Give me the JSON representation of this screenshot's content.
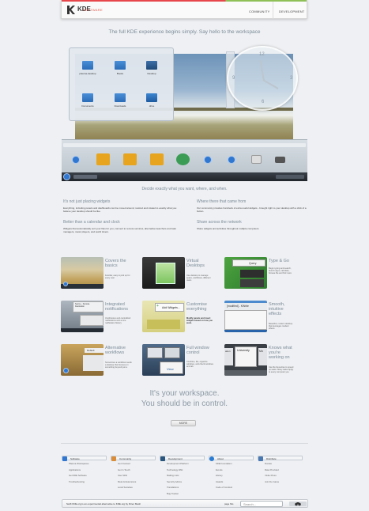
{
  "nav": {
    "logo": "KDE",
    "logo_sub": "SOFTWARE",
    "items": [
      "COMMUNITY",
      "DEVELOPMENT"
    ]
  },
  "hero": {
    "headline": "The full KDE experience begins simply. Say hello to the workspace",
    "folderview": [
      "plasma-desktop",
      "Books",
      "Desktop",
      "Documents",
      "Downloads",
      "drive"
    ],
    "clock": [
      "12",
      "3",
      "6",
      "9"
    ]
  },
  "section2": {
    "headline": "Decide exactly what you want, where, and when.",
    "cols": [
      {
        "h": "It's not just placing widgets",
        "p": "Everything, including panels and dashboards can be moved around, resized and rotated to exactly what you believe your desktop should be like."
      },
      {
        "h": "Where there that came from",
        "p": "Our community provides hundreds of extra useful widgets - brought right to your desktop with a click of a button."
      },
      {
        "h": "Better than a calendar and clock",
        "p": "Widgets that automatically sort your files for you, connect to remote services, alternative launchers and task managers, music players, and world timers."
      },
      {
        "h": "Share across the network",
        "p": "Share widgets and activities throughout multiple computers."
      }
    ]
  },
  "tiles": [
    {
      "title": "Covers the basics",
      "desc": "Familiar, easy to pick up for every user"
    },
    {
      "title": "Virtual Desktops",
      "desc": "Use desktop to manage space, workflows, different users"
    },
    {
      "title": "Type & Go",
      "desc": "Begin typing and search, launch apps, calculate, browse file and find more"
    },
    {
      "title": "Integrated notifications",
      "desc": "Unobtrusive and centralized notifications and a nice notification history"
    },
    {
      "title": "Customise everything",
      "desc": "Modify panels and insert widgets based on how you work."
    },
    {
      "title": "Smooth, intuitive effects",
      "desc": "Beautiful, modern desktop that leverages modern effects"
    },
    {
      "title": "Alternative workflows",
      "desc": "Sometimes a workflow needs a desktop that focuses on something beyond just a"
    },
    {
      "title": "Full window control",
      "desc": "Combine, tile, organize windows, and check windows and tab"
    },
    {
      "title": "Knows what you're working on",
      "desc": "Use file favourites to speed up tasks. Many tasks apply to every computer you"
    }
  ],
  "tile_labels": {
    "t3": "Query",
    "t4a": "Source - Konsole",
    "t4b": "Destination",
    "t4c": "Konsole",
    "t5": "Add Widgets...",
    "t6": "[modified] - KWrite",
    "t7": "Default",
    "t8": "View",
    "t9a": "ation",
    "t9b": "University",
    "t9c": "Mo"
  },
  "slogan": [
    "It's your workspace.",
    "You should be in control."
  ],
  "more": "MORE",
  "footer": {
    "cols": [
      {
        "title": "Software",
        "color": "#2f77d1",
        "links": [
          "Plasma Workspaces",
          "Applications",
          "Get KDE Software",
          "Troubleshooting"
        ]
      },
      {
        "title": "Community",
        "color": "#d98d3a",
        "links": [
          "Get Involved",
          "Get in Touch",
          "User Wiki",
          "Meta & Extensions",
          "Local Societies"
        ]
      },
      {
        "title": "Development",
        "color": "#29557e",
        "links": [
          "Development Platform",
          "Technology Wiki",
          "Mailing Lists",
          "Security Advice",
          "Translations",
          "Bug Tracker"
        ]
      },
      {
        "title": "About",
        "color": "#2a7cd3",
        "links": [
          "KDE Foundation",
          "Events",
          "History",
          "Awards",
          "Code of Conduct"
        ]
      },
      {
        "title": "Distribute",
        "color": "#4a78b0",
        "links": [
          "Donate",
          "Rate Provided",
          "Visite Press",
          "Join the Game"
        ]
      }
    ],
    "note": "Swift KDE.org is an experimental alternative to KDE.org by Diner Mesh",
    "lang": "page hits",
    "search_placeholder": "Search..."
  }
}
